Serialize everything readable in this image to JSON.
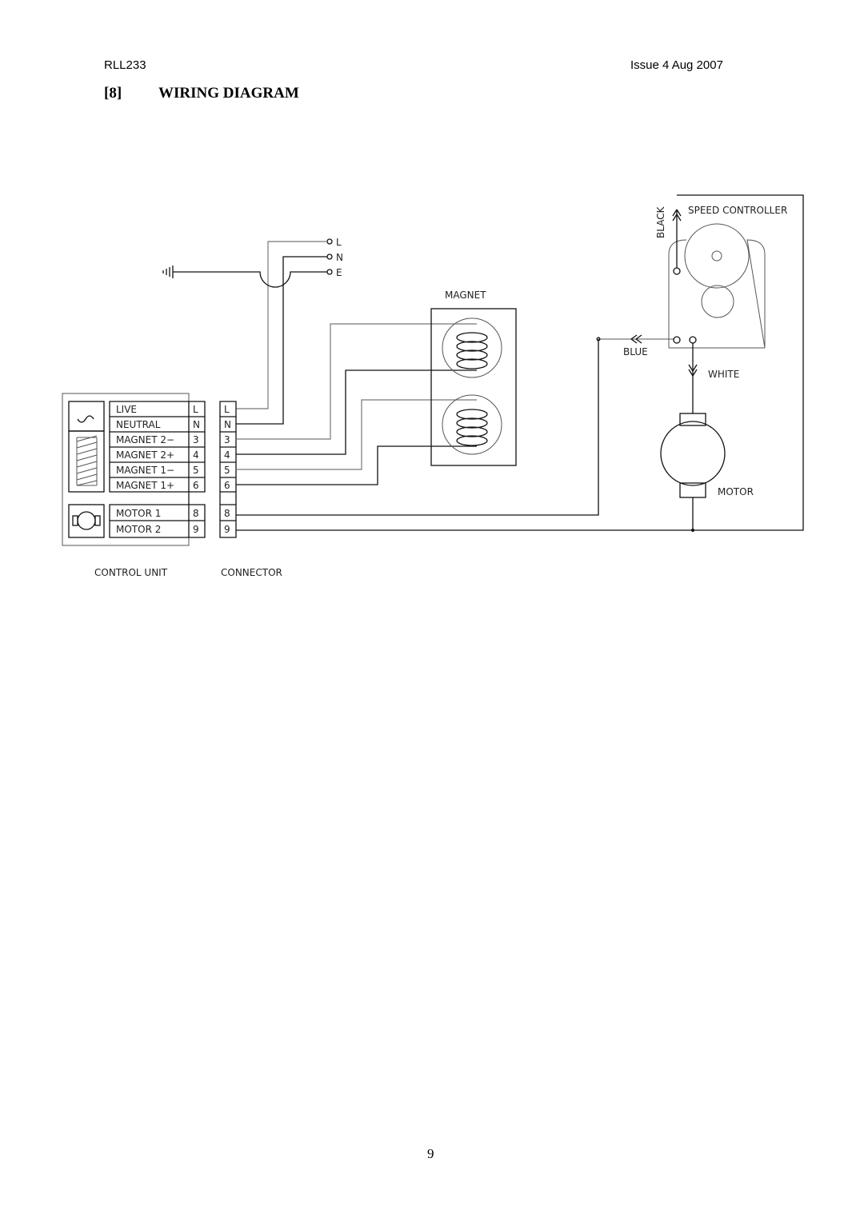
{
  "header": {
    "doc_code": "RLL233",
    "issue": "Issue 4 Aug 2007"
  },
  "section": {
    "number": "[8]",
    "title": "WIRING DIAGRAM"
  },
  "diagram": {
    "supply_terminals": [
      "L",
      "N",
      "E"
    ],
    "control_unit_rows": [
      {
        "label": "LIVE",
        "pin": "L"
      },
      {
        "label": "NEUTRAL",
        "pin": "N"
      },
      {
        "label": "MAGNET 2−",
        "pin": "3"
      },
      {
        "label": "MAGNET 2+",
        "pin": "4"
      },
      {
        "label": "MAGNET 1−",
        "pin": "5"
      },
      {
        "label": "MAGNET 1+",
        "pin": "6"
      },
      {
        "label": "MOTOR 1",
        "pin": "8"
      },
      {
        "label": "MOTOR 2",
        "pin": "9"
      }
    ],
    "connector_pins": [
      "L",
      "N",
      "3",
      "4",
      "5",
      "6",
      "8",
      "9"
    ],
    "control_unit_label": "CONTROL UNIT",
    "connector_label": "CONNECTOR",
    "magnet_label": "MAGNET",
    "speed_controller_label": "SPEED CONTROLLER",
    "wire_black": "BLACK",
    "wire_blue": "BLUE",
    "wire_white": "WHITE",
    "motor_label": "MOTOR"
  },
  "page_number": "9"
}
